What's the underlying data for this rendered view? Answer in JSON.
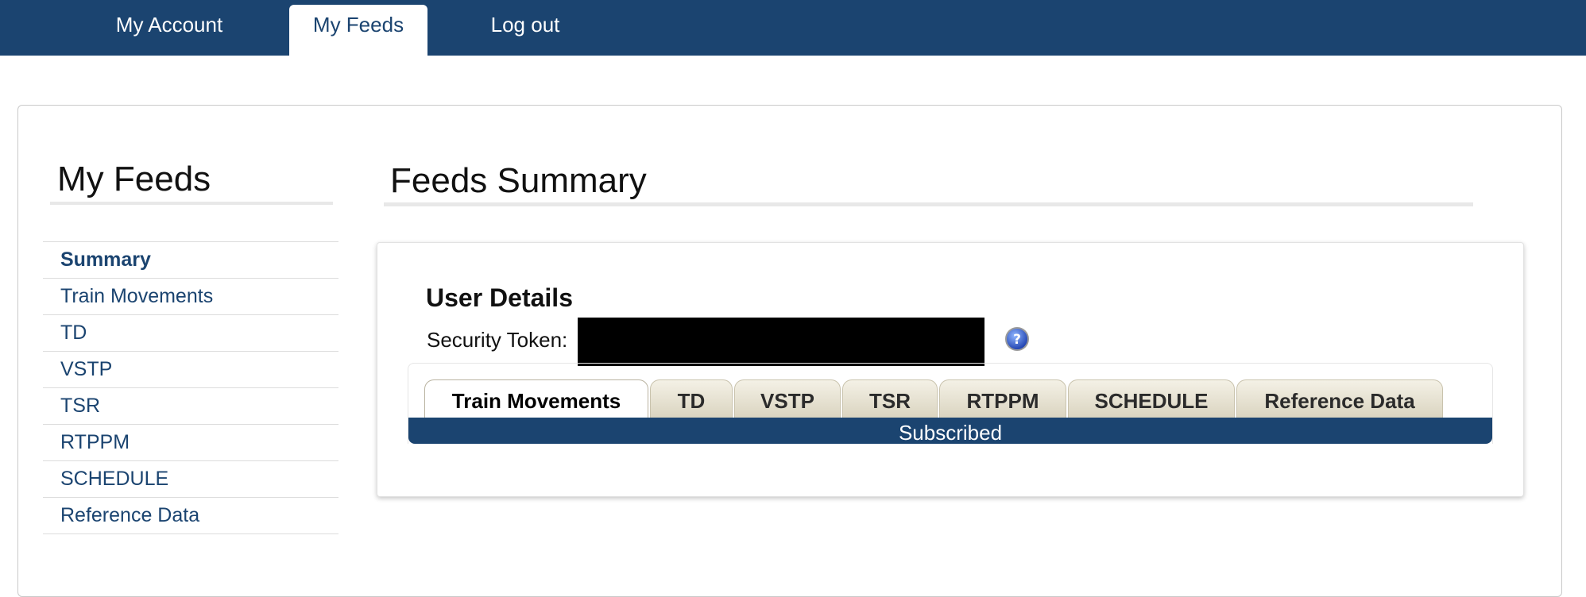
{
  "topnav": {
    "items": [
      {
        "label": "My Account"
      },
      {
        "label": "My Feeds"
      },
      {
        "label": "Log out"
      }
    ]
  },
  "sidebar": {
    "title": "My Feeds",
    "items": [
      {
        "label": "Summary"
      },
      {
        "label": "Train Movements"
      },
      {
        "label": "TD"
      },
      {
        "label": "VSTP"
      },
      {
        "label": "TSR"
      },
      {
        "label": "RTPPM"
      },
      {
        "label": "SCHEDULE"
      },
      {
        "label": "Reference Data"
      }
    ]
  },
  "main": {
    "title": "Feeds Summary",
    "user_details": {
      "heading": "User Details",
      "token_label": "Security Token:",
      "token_value": ""
    },
    "tabs": [
      {
        "label": "Train Movements"
      },
      {
        "label": "TD"
      },
      {
        "label": "VSTP"
      },
      {
        "label": "TSR"
      },
      {
        "label": "RTPPM"
      },
      {
        "label": "SCHEDULE"
      },
      {
        "label": "Reference Data"
      }
    ],
    "selected_tab": "Train Movements",
    "status": "Subscribed"
  },
  "colors": {
    "brand": "#1b4470",
    "tab_bg": "#e6e1cf",
    "redaction": "#000000"
  },
  "icons": {
    "help": "question-circle-icon"
  }
}
